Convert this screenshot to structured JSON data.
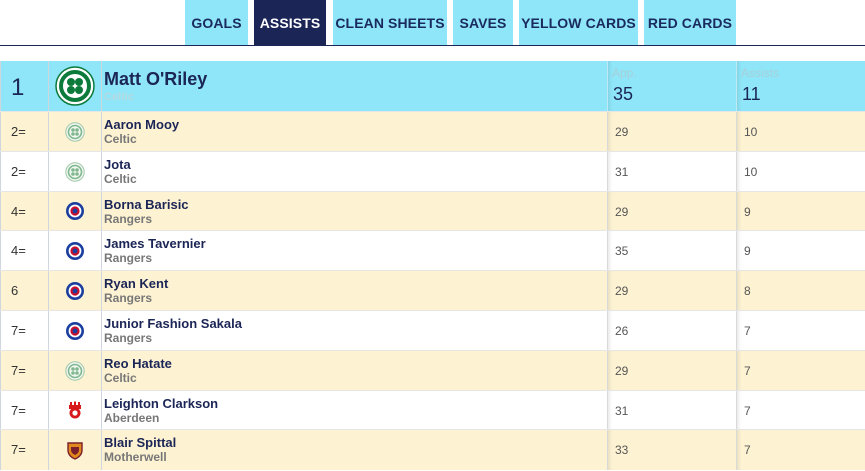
{
  "tabs": [
    {
      "label": "GOALS",
      "active": false
    },
    {
      "label": "ASSISTS",
      "active": true
    },
    {
      "label": "CLEAN SHEETS",
      "active": false
    },
    {
      "label": "SAVES",
      "active": false
    },
    {
      "label": "YELLOW CARDS",
      "active": false
    },
    {
      "label": "RED CARDS",
      "active": false
    }
  ],
  "columns": {
    "app": "App.",
    "assists": "Assists"
  },
  "leader": {
    "rank": "1",
    "name": "Matt O'Riley",
    "club": "Celtic",
    "crest": "celtic-crest-icon",
    "app": "35",
    "assists": "11"
  },
  "rows": [
    {
      "rank": "2=",
      "name": "Aaron Mooy",
      "club": "Celtic",
      "crest": "celtic-crest-icon",
      "app": "29",
      "assists": "10"
    },
    {
      "rank": "2=",
      "name": "Jota",
      "club": "Celtic",
      "crest": "celtic-crest-icon",
      "app": "31",
      "assists": "10"
    },
    {
      "rank": "4=",
      "name": "Borna Barisic",
      "club": "Rangers",
      "crest": "rangers-crest-icon",
      "app": "29",
      "assists": "9"
    },
    {
      "rank": "4=",
      "name": "James Tavernier",
      "club": "Rangers",
      "crest": "rangers-crest-icon",
      "app": "35",
      "assists": "9"
    },
    {
      "rank": "6",
      "name": "Ryan Kent",
      "club": "Rangers",
      "crest": "rangers-crest-icon",
      "app": "29",
      "assists": "8"
    },
    {
      "rank": "7=",
      "name": "Junior Fashion Sakala",
      "club": "Rangers",
      "crest": "rangers-crest-icon",
      "app": "26",
      "assists": "7"
    },
    {
      "rank": "7=",
      "name": "Reo Hatate",
      "club": "Celtic",
      "crest": "celtic-crest-icon",
      "app": "29",
      "assists": "7"
    },
    {
      "rank": "7=",
      "name": "Leighton Clarkson",
      "club": "Aberdeen",
      "crest": "aberdeen-crest-icon",
      "app": "31",
      "assists": "7"
    },
    {
      "rank": "7=",
      "name": "Blair Spittal",
      "club": "Motherwell",
      "crest": "motherwell-crest-icon",
      "app": "33",
      "assists": "7"
    }
  ],
  "colors": {
    "tab": "#8ee6f8",
    "tab_active": "#1b2556",
    "row_alt": "#fdf3d3",
    "leader_bg": "#8ee6f8"
  }
}
